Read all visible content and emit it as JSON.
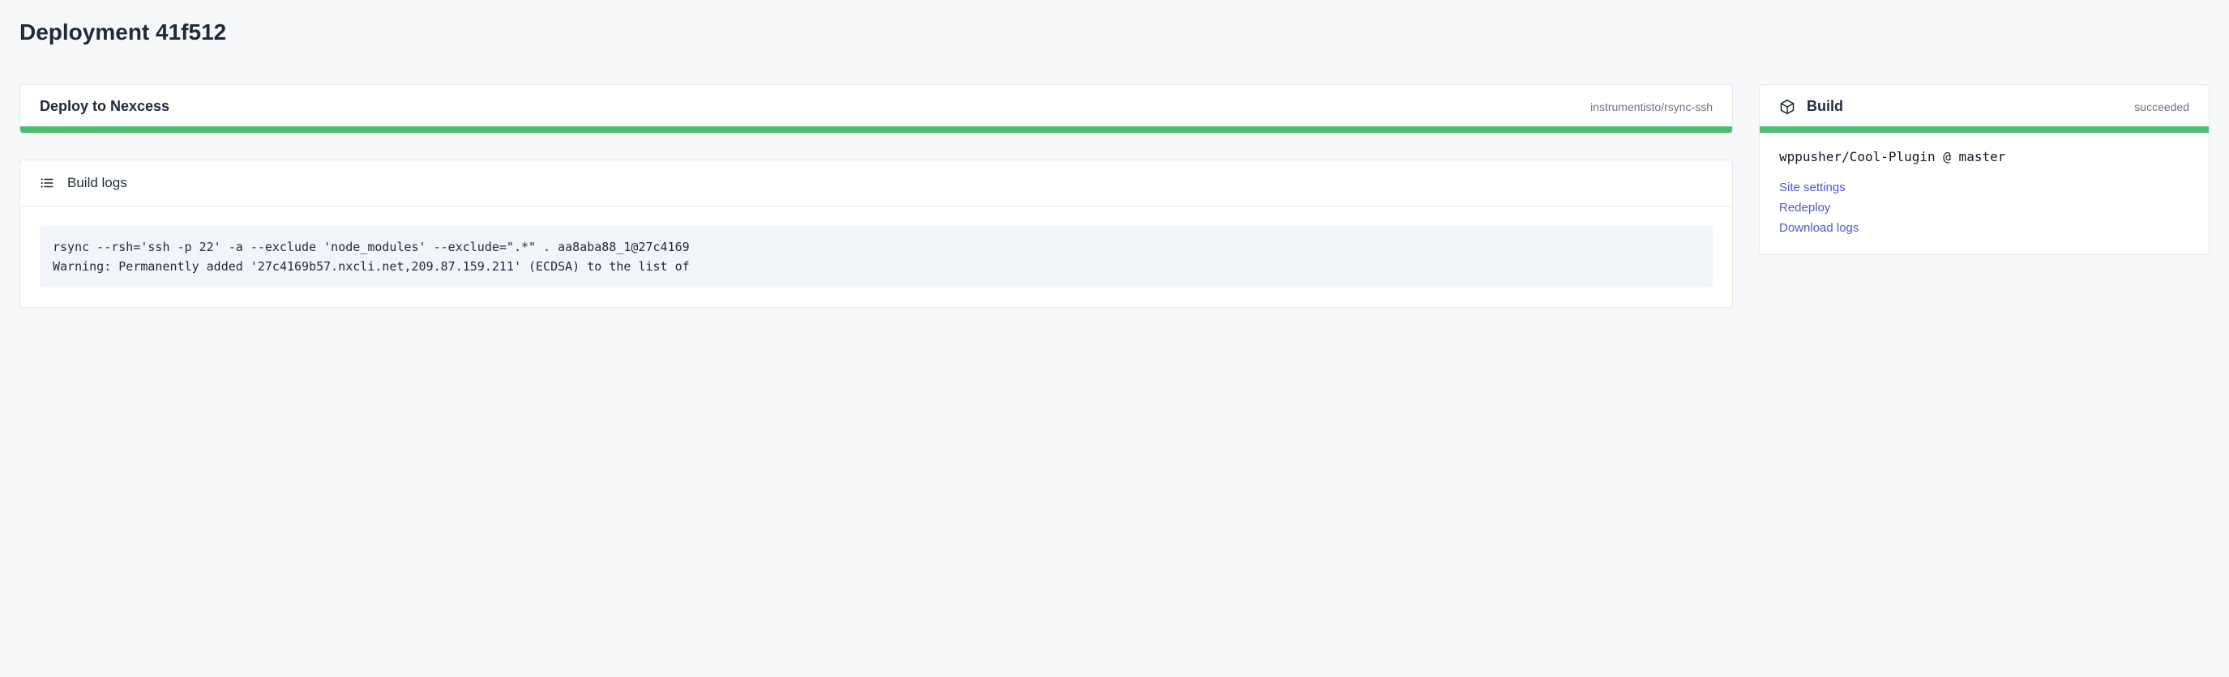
{
  "page": {
    "title": "Deployment 41f512"
  },
  "deploy": {
    "title": "Deploy to Nexcess",
    "image": "instrumentisto/rsync-ssh",
    "status_color": "#4ebd6f"
  },
  "logs": {
    "title": "Build logs",
    "lines": [
      "rsync --rsh='ssh -p 22' -a --exclude 'node_modules' --exclude=\".*\" . aa8aba88_1@27c4169",
      "Warning: Permanently added '27c4169b57.nxcli.net,209.87.159.211' (ECDSA) to the list of"
    ]
  },
  "build": {
    "title": "Build",
    "status": "succeeded",
    "repo": "wppusher/Cool-Plugin @ master",
    "actions": {
      "site_settings": "Site settings",
      "redeploy": "Redeploy",
      "download_logs": "Download logs"
    }
  }
}
